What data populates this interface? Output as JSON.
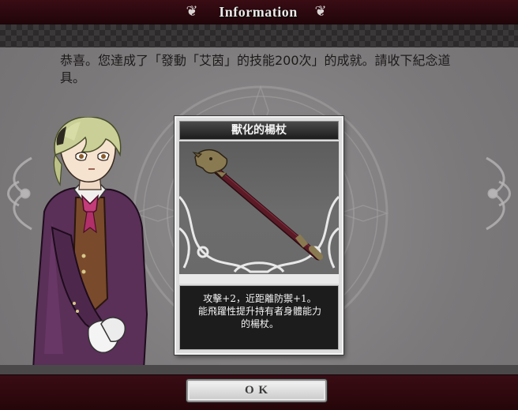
{
  "header": {
    "title": "Information",
    "ornament_left_icon": "scroll-ornament-icon",
    "ornament_right_icon": "scroll-ornament-icon"
  },
  "message": {
    "text": "恭喜。您達成了「發動「艾茵」的技能200次」的成就。請收下紀念道具。"
  },
  "item": {
    "name": "獸化的楊杖",
    "description_line1": "攻擊+2，近距離防禦+1。",
    "description_line2": "能飛躍性提升持有者身體能力",
    "description_line3": "的楊杖。",
    "icon": "wooden-staff-icon"
  },
  "footer": {
    "ok_label": "O K"
  },
  "colors": {
    "title_bar": "#2a080e",
    "panel": "#7d7b7c",
    "card_desc_bg": "#1c1c1c",
    "staff_shaft": "#4a1520",
    "staff_head": "#8a7a52"
  }
}
